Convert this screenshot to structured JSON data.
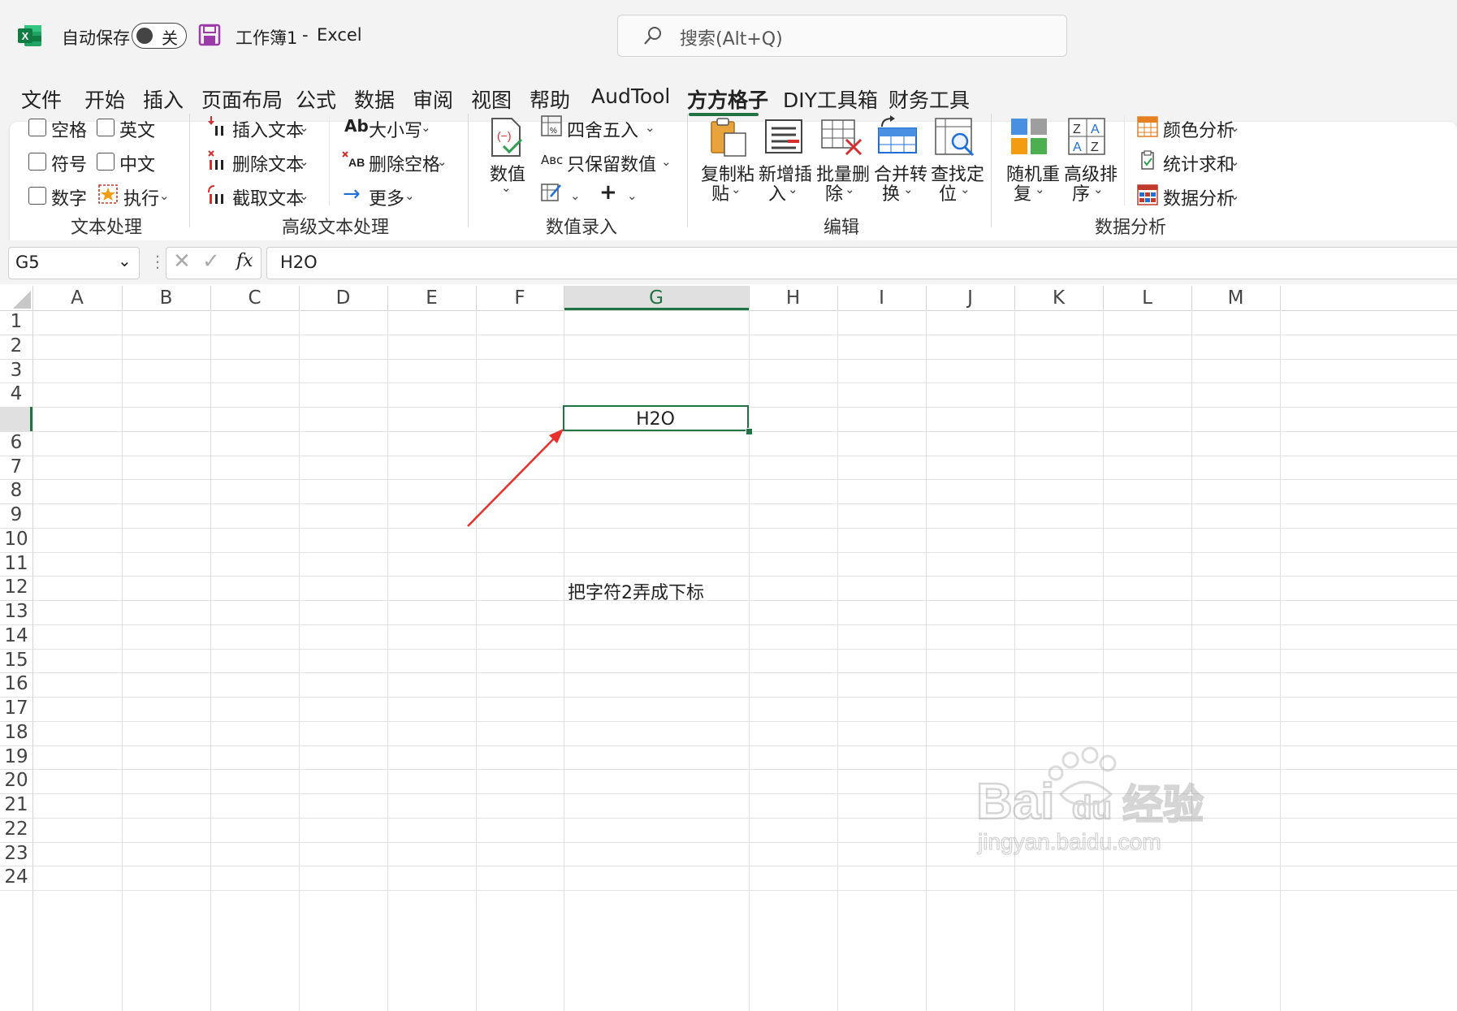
{
  "titlebar": {
    "autosave_label": "自动保存",
    "autosave_state": "关",
    "workbook_title": "工作簿1",
    "title_separator": "-",
    "app_name": "Excel",
    "search_placeholder": "搜索(Alt+Q)"
  },
  "tabs": [
    "文件",
    "开始",
    "插入",
    "页面布局",
    "公式",
    "数据",
    "审阅",
    "视图",
    "帮助",
    "AudTool",
    "方方格子",
    "DIY工具箱",
    "财务工具"
  ],
  "active_tab": "方方格子",
  "ribbon": {
    "text_group": {
      "label": "文本处理",
      "checkboxes": [
        "空格",
        "英文",
        "符号",
        "中文",
        "数字"
      ],
      "execute": "执行"
    },
    "advanced_text_group": {
      "label": "高级文本处理",
      "insert_text": "插入文本",
      "delete_text": "删除文本",
      "extract_text": "截取文本",
      "case": "大小写",
      "delete_spaces": "删除空格",
      "more": "更多"
    },
    "number_group": {
      "label": "数值录入",
      "value": "数值",
      "round": "四舍五入",
      "keep_values": "只保留数值"
    },
    "edit_group": {
      "label": "编辑",
      "copy_paste": [
        "复制粘",
        "贴"
      ],
      "insert_new": [
        "新增插",
        "入"
      ],
      "batch_delete": [
        "批量删",
        "除"
      ],
      "merge_convert": [
        "合并转",
        "换"
      ],
      "find_locate": [
        "查找定",
        "位"
      ]
    },
    "analysis_group": {
      "label": "数据分析",
      "random_repeat": [
        "随机重",
        "复"
      ],
      "advanced_sort": [
        "高级排",
        "序"
      ],
      "color_analysis": "颜色分析",
      "stat_sum": "统计求和",
      "data_analysis": "数据分析"
    }
  },
  "formula_bar": {
    "name_box": "G5",
    "fx": "fx",
    "value": "H2O"
  },
  "columns": [
    "A",
    "B",
    "C",
    "D",
    "E",
    "F",
    "G",
    "H",
    "I",
    "J",
    "K",
    "L",
    "M"
  ],
  "rows": [
    "1",
    "2",
    "3",
    "4",
    "5",
    "6",
    "7",
    "8",
    "9",
    "10",
    "11",
    "12",
    "13",
    "14",
    "15",
    "16",
    "17",
    "18",
    "19",
    "20",
    "21",
    "22",
    "23",
    "24"
  ],
  "cells": {
    "G5": "H2O",
    "G12": "把字符2弄成下标"
  },
  "watermark": {
    "brand": "Bai经验",
    "url": "jingyan.baidu.com"
  },
  "colors": {
    "accent_green": "#217346",
    "arrow_red": "#e8302c"
  }
}
